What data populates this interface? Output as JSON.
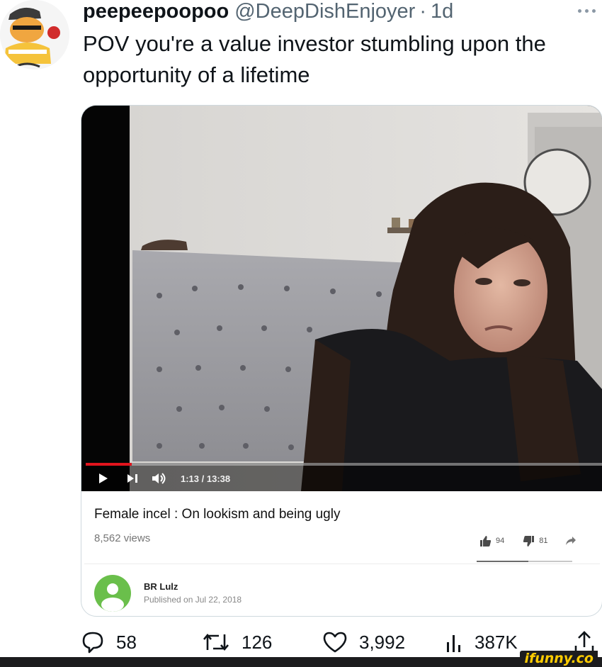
{
  "tweet": {
    "display_name": "peepeepoopoo",
    "handle": "@DeepDishEnjoyer",
    "separator": "·",
    "time": "1d",
    "text": "POV you're a value investor stumbling upon the opportunity of a lifetime",
    "more_icon": "more-horizontal-icon"
  },
  "video": {
    "current_time": "1:13",
    "total_time": "13:38",
    "time_readout": "1:13 / 13:38",
    "progress": 0.089,
    "title": "Female incel : On lookism and being ugly",
    "views": "8,562 views",
    "likes": "94",
    "dislikes": "81",
    "like_ratio": 0.54,
    "channel_name": "BR Lulz",
    "published": "Published on Jul 22, 2018",
    "icons": [
      "play-icon",
      "next-icon",
      "volume-icon",
      "thumbs-up-icon",
      "thumbs-down-icon",
      "share-icon"
    ]
  },
  "engagement": {
    "replies": "58",
    "retweets": "126",
    "likes": "3,992",
    "views": "387K",
    "icons": [
      "reply-icon",
      "retweet-icon",
      "like-icon",
      "views-icon",
      "share-icon"
    ]
  },
  "watermark": "ifunny.co",
  "colors": {
    "text": "#0f1419",
    "secondary": "#536471",
    "youtube_red": "#e1141d",
    "ifunny_yellow": "#ffcc00"
  }
}
